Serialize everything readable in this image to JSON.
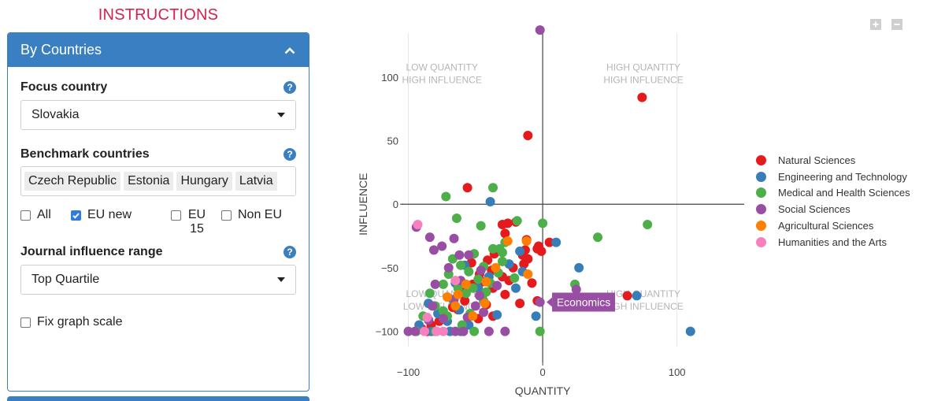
{
  "instructions_label": "INSTRUCTIONS",
  "panel": {
    "title": "By Countries",
    "focus_label": "Focus country",
    "focus_value": "Slovakia",
    "benchmark_label": "Benchmark countries",
    "benchmark_chips": [
      "Czech Republic",
      "Estonia",
      "Hungary",
      "Latvia"
    ],
    "checks": [
      {
        "label": "All",
        "checked": false
      },
      {
        "label": "EU new",
        "checked": true
      },
      {
        "label": "EU 15",
        "checked": false
      },
      {
        "label": "Non EU",
        "checked": false
      }
    ],
    "range_label": "Journal influence range",
    "range_value": "Top Quartile",
    "fix_scale_label": "Fix graph scale",
    "fix_scale_checked": false
  },
  "help_icon": "?",
  "quadrants": {
    "top_left": [
      "LOW QUANTITY",
      "HIGH INFLUENCE"
    ],
    "top_right": [
      "HIGH QUANTITY",
      "HIGH INFLUENCE"
    ],
    "bottom_left": [
      "LOW QUANTITY",
      "LOW INFLUENCE"
    ],
    "bottom_right": [
      "HIGH QUANTITY",
      "HIGH INFLUENCE"
    ]
  },
  "tooltip": "Economics",
  "colors": {
    "accent": "#3a7fc1",
    "instructions": "#d6214f"
  },
  "chart_data": {
    "type": "scatter",
    "xlabel": "QUANTITY",
    "ylabel": "INFLUENCE",
    "xlim": [
      -105,
      150
    ],
    "ylim": [
      -112,
      142
    ],
    "xticks": [
      -100,
      0,
      100
    ],
    "yticks": [
      100,
      50,
      0,
      -50,
      -100
    ],
    "series": [
      {
        "name": "Natural Sciences",
        "color": "#e41a1c",
        "points": [
          [
            74,
            84
          ],
          [
            -11,
            54
          ],
          [
            -56,
            13
          ],
          [
            -20,
            -14
          ],
          [
            -26,
            -15
          ],
          [
            -30,
            -16
          ],
          [
            -28,
            -23
          ],
          [
            -12,
            -28
          ],
          [
            -3,
            -33
          ],
          [
            -13,
            -36
          ],
          [
            -15,
            -40
          ],
          [
            -4,
            -35
          ],
          [
            -1,
            -37
          ],
          [
            -36,
            -39
          ],
          [
            -41,
            -44
          ],
          [
            -38,
            -52
          ],
          [
            -47,
            -55
          ],
          [
            -14,
            -47
          ],
          [
            -11,
            -43
          ],
          [
            -22,
            -50
          ],
          [
            -30,
            -57
          ],
          [
            -45,
            -61
          ],
          [
            -52,
            -63
          ],
          [
            -37,
            -66
          ],
          [
            -28,
            -71
          ],
          [
            -58,
            -76
          ],
          [
            -42,
            -79
          ],
          [
            -63,
            -83
          ],
          [
            -67,
            -81
          ],
          [
            -48,
            -90
          ],
          [
            -37,
            -88
          ],
          [
            -77,
            -92
          ],
          [
            -83,
            -95
          ],
          [
            -90,
            -98
          ],
          [
            -86,
            -100
          ],
          [
            -4,
            -76
          ],
          [
            63,
            -72
          ],
          [
            -17,
            -78
          ],
          [
            -60,
            -69
          ],
          [
            -45,
            -72
          ],
          [
            -25,
            -60
          ],
          [
            5,
            -30
          ],
          [
            -8,
            -62
          ],
          [
            -53,
            -46
          ]
        ]
      },
      {
        "name": "Engineering and Technology",
        "color": "#377eb8",
        "points": [
          [
            -39,
            2
          ],
          [
            10,
            -30
          ],
          [
            27,
            -50
          ],
          [
            -17,
            -37
          ],
          [
            -25,
            -47
          ],
          [
            -65,
            -62
          ],
          [
            -48,
            -66
          ],
          [
            -85,
            -78
          ],
          [
            -62,
            -83
          ],
          [
            -78,
            -86
          ],
          [
            -34,
            -87
          ],
          [
            -5,
            -88
          ],
          [
            -71,
            -92
          ],
          [
            -55,
            -95
          ],
          [
            -83,
            -100
          ],
          [
            -69,
            -100
          ],
          [
            -61,
            -100
          ],
          [
            -79,
            -100
          ],
          [
            110,
            -100
          ],
          [
            70,
            -72
          ],
          [
            -20,
            -66
          ],
          [
            -15,
            -53
          ],
          [
            -92,
            -95
          ],
          [
            -40,
            -57
          ],
          [
            -58,
            -48
          ]
        ]
      },
      {
        "name": "Medical and Health Sciences",
        "color": "#4daf4a",
        "points": [
          [
            -72,
            6
          ],
          [
            -37,
            13
          ],
          [
            -64,
            -11
          ],
          [
            -46,
            -17
          ],
          [
            -19,
            -13
          ],
          [
            0,
            -15
          ],
          [
            78,
            -16
          ],
          [
            41,
            -26
          ],
          [
            -28,
            -30
          ],
          [
            -37,
            -35
          ],
          [
            -32,
            -35
          ],
          [
            -30,
            -38
          ],
          [
            -51,
            -39
          ],
          [
            -67,
            -43
          ],
          [
            -61,
            -48
          ],
          [
            -44,
            -49
          ],
          [
            -55,
            -53
          ],
          [
            -33,
            -54
          ],
          [
            -48,
            -59
          ],
          [
            -21,
            -58
          ],
          [
            -39,
            -62
          ],
          [
            -74,
            -63
          ],
          [
            -63,
            -66
          ],
          [
            -52,
            -66
          ],
          [
            -57,
            -70
          ],
          [
            -67,
            -75
          ],
          [
            -44,
            -76
          ],
          [
            -80,
            -80
          ],
          [
            -74,
            -84
          ],
          [
            -54,
            -86
          ],
          [
            -89,
            -88
          ],
          [
            -71,
            -88
          ],
          [
            -60,
            -95
          ],
          [
            -51,
            -100
          ],
          [
            -2,
            -100
          ],
          [
            -80,
            -100
          ],
          [
            -94,
            -100
          ],
          [
            -30,
            -45
          ],
          [
            -84,
            -70
          ],
          [
            -42,
            -69
          ],
          [
            24,
            -63
          ],
          [
            -70,
            -55
          ]
        ]
      },
      {
        "name": "Social Sciences",
        "color": "#984ea3",
        "points": [
          [
            -2,
            137
          ],
          [
            -94,
            -18
          ],
          [
            -84,
            -26
          ],
          [
            -66,
            -27
          ],
          [
            -81,
            -36
          ],
          [
            -75,
            -33
          ],
          [
            -55,
            -40
          ],
          [
            -62,
            -40
          ],
          [
            -46,
            -52
          ],
          [
            -61,
            -60
          ],
          [
            -80,
            -63
          ],
          [
            -34,
            -64
          ],
          [
            -47,
            -72
          ],
          [
            -66,
            -75
          ],
          [
            -82,
            -80
          ],
          [
            -74,
            -90
          ],
          [
            -44,
            -85
          ],
          [
            -56,
            -89
          ],
          [
            -85,
            -91
          ],
          [
            -100,
            -100
          ],
          [
            -95,
            -100
          ],
          [
            -65,
            -100
          ],
          [
            -59,
            -100
          ],
          [
            -40,
            -100
          ],
          [
            -28,
            -100
          ],
          [
            -2,
            -77
          ],
          [
            25,
            -67
          ],
          [
            -70,
            -50
          ],
          [
            -50,
            -80
          ]
        ]
      },
      {
        "name": "Agricultural Sciences",
        "color": "#ff7f00",
        "points": [
          [
            -12,
            -29
          ],
          [
            -26,
            -29
          ],
          [
            -11,
            -55
          ],
          [
            -42,
            -61
          ],
          [
            -57,
            -63
          ],
          [
            -63,
            -71
          ],
          [
            -71,
            -73
          ],
          [
            -43,
            -78
          ],
          [
            -65,
            -80
          ],
          [
            -52,
            -88
          ],
          [
            -35,
            -50
          ]
        ]
      },
      {
        "name": "Humanities and the Arts",
        "color": "#f781bf",
        "points": [
          [
            -93,
            -16
          ],
          [
            -65,
            -60
          ],
          [
            -86,
            -89
          ],
          [
            -79,
            -100
          ],
          [
            -88,
            -100
          ],
          [
            -74,
            -100
          ]
        ]
      }
    ]
  }
}
